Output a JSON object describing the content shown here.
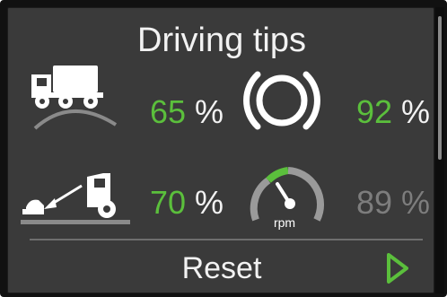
{
  "screen": {
    "title": "Driving tips",
    "colors": {
      "background": "#3a3a3a",
      "accent_green": "#5bbf3c",
      "text": "#f2f2f2",
      "dimmed": "#7d7d7d"
    }
  },
  "tips": [
    {
      "icon": "truck-on-hill-icon",
      "number": "65",
      "unit": " %",
      "dimmed": false
    },
    {
      "icon": "brake-icon",
      "number": "92",
      "unit": " %",
      "dimmed": false
    },
    {
      "icon": "coasting-truck-icon",
      "number": "70",
      "unit": " %",
      "dimmed": false
    },
    {
      "icon": "rpm-gauge-icon",
      "number": "89",
      "unit": " %",
      "dimmed": true,
      "gauge_label": "rpm"
    }
  ],
  "footer": {
    "reset_label": "Reset",
    "next_icon": "play-arrow-icon"
  },
  "scrollbar": {
    "visible": true
  }
}
